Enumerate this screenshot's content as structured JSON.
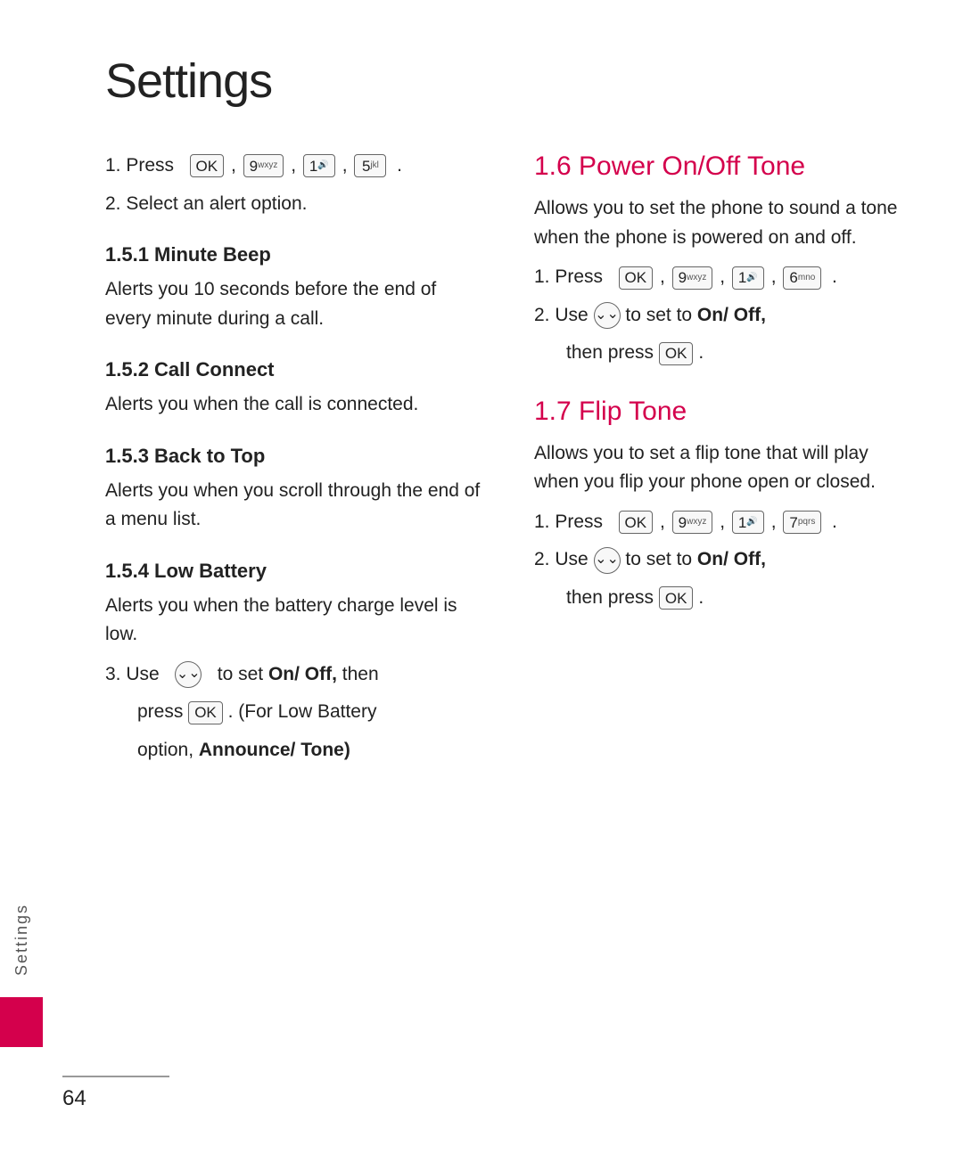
{
  "page": {
    "title": "Settings",
    "page_number": "64",
    "sidebar_label": "Settings"
  },
  "left_col": {
    "step1_prefix": "1. Press",
    "step1_keys": [
      "OK",
      "9wxyz",
      "1",
      "5jkl"
    ],
    "step2": "2. Select an alert option.",
    "sections": [
      {
        "id": "1.5.1",
        "heading": "1.5.1 Minute Beep",
        "text": "Alerts you 10 seconds before the end of every minute during a call."
      },
      {
        "id": "1.5.2",
        "heading": "1.5.2 Call Connect",
        "text": "Alerts you when the call is connected."
      },
      {
        "id": "1.5.3",
        "heading": "1.5.3 Back to Top",
        "text": "Alerts you when you scroll through the end of a menu list."
      },
      {
        "id": "1.5.4",
        "heading": "1.5.4 Low Battery",
        "text": "Alerts you when the battery charge level is low."
      }
    ],
    "step3_text": "3. Use",
    "step3_middle": "to set",
    "step3_on": "On/",
    "step3_off": "Off,",
    "step3_end": "then",
    "step3_press": "press",
    "step3_ok_label": "OK",
    "step3_paren": ". (For Low Battery",
    "step3_option": "option,",
    "step3_announce": "Announce/",
    "step3_tone": "Tone)"
  },
  "right_col": {
    "section_16": {
      "heading": "1.6 Power On/Off Tone",
      "text": "Allows you to set the phone to sound a tone when the phone is powered on and off.",
      "step1_prefix": "1. Press",
      "step1_keys": [
        "OK",
        "9wxyz",
        "1",
        "6mno"
      ],
      "step2_text": "2. Use",
      "step2_middle": "to set to",
      "step2_on": "On/",
      "step2_off": "Off,",
      "step2_then": "then press",
      "step2_ok": "OK",
      "step2_period": "."
    },
    "section_17": {
      "heading": "1.7 Flip Tone",
      "text": "Allows you to set a flip tone that will play when you flip your phone open or closed.",
      "step1_prefix": "1. Press",
      "step1_keys": [
        "OK",
        "9wxyz",
        "1",
        "7pqrs"
      ],
      "step2_text": "2. Use",
      "step2_middle": "to set to",
      "step2_on": "On/",
      "step2_off": "Off,",
      "step2_then": "then press",
      "step2_ok": "OK",
      "step2_period": "."
    }
  }
}
